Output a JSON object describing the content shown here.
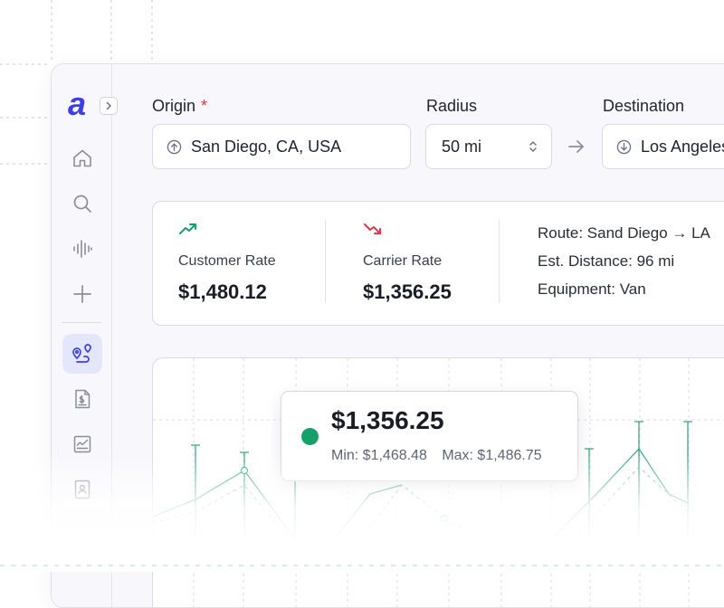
{
  "app": {
    "logo_text": "a",
    "brand_color": "#3d3ee6"
  },
  "sidebar": {
    "items": [
      {
        "icon": "home-icon",
        "active": false
      },
      {
        "icon": "search-icon",
        "active": false
      },
      {
        "icon": "waveform-icon",
        "active": false
      },
      {
        "icon": "plus-icon",
        "active": false
      },
      {
        "icon": "route-pin-icon",
        "active": true
      },
      {
        "icon": "invoice-icon",
        "active": false
      },
      {
        "icon": "chart-report-icon",
        "active": false
      },
      {
        "icon": "contact-book-icon",
        "active": false
      }
    ]
  },
  "search": {
    "origin_label": "Origin",
    "origin_required": "*",
    "origin_value": "San Diego, CA, USA",
    "radius_label": "Radius",
    "radius_value": "50 mi",
    "destination_label": "Destination",
    "destination_value": "Los Angeles"
  },
  "rates": {
    "customer_title": "Customer Rate",
    "customer_value": "$1,480.12",
    "customer_trend": "up",
    "carrier_title": "Carrier Rate",
    "carrier_value": "$1,356.25",
    "carrier_trend": "down",
    "route": "Route: Sand Diego → LA",
    "distance": "Est. Distance: 96 mi",
    "equipment": "Equipment: Van"
  },
  "tooltip": {
    "value": "$1,356.25",
    "min": "Min: $1,468.48",
    "max": "Max: $1,486.75"
  },
  "colors": {
    "accent_green": "#14a06a",
    "trend_up": "#14a06a",
    "trend_down": "#e0344a",
    "active_nav_bg": "#e4e6fb"
  }
}
